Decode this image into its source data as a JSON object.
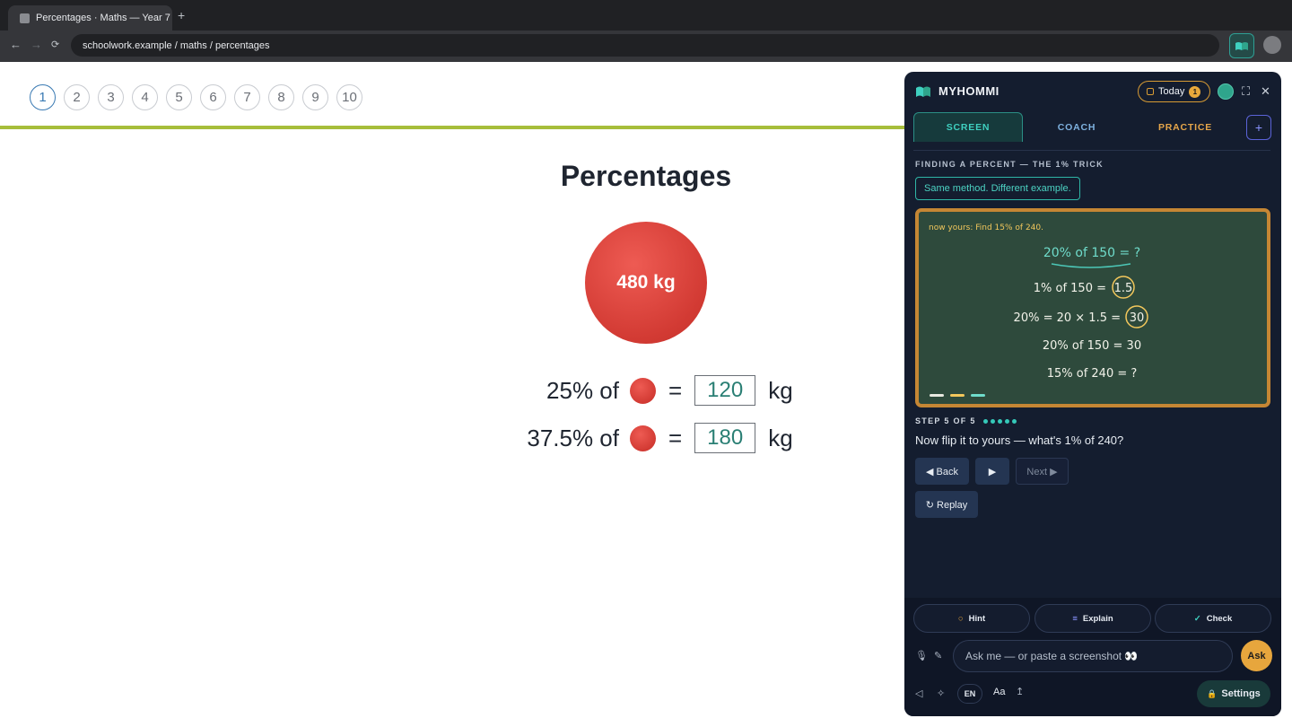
{
  "browser": {
    "tab_title": "Percentages · Maths — Year 7",
    "new_tab": "+",
    "back": "←",
    "forward": "→",
    "reload": "⟳",
    "url": "schoolwork.example / maths / percentages"
  },
  "page": {
    "questions": [
      "1",
      "2",
      "3",
      "4",
      "5",
      "6",
      "7",
      "8",
      "9",
      "10"
    ],
    "active_question": "1",
    "title": "Percentages",
    "ball_label": "480 kg",
    "equations": [
      {
        "percent": "25% of",
        "equals": "=",
        "answer": "120",
        "unit": "kg"
      },
      {
        "percent": "37.5% of",
        "equals": "=",
        "answer": "180",
        "unit": "kg"
      }
    ]
  },
  "panel": {
    "brand": "MYHOMMI",
    "today_label": "Today",
    "today_count": "1",
    "expand_icon": "⛶",
    "close_icon": "✕",
    "tabs": [
      "SCREEN",
      "COACH",
      "PRACTICE"
    ],
    "add_tab": "+",
    "section_label": "FINDING A PERCENT — THE 1% TRICK",
    "pill": "Same method. Different example.",
    "board": {
      "note": "now yours: Find 15% of 240.",
      "line1": "20% of 150 = ?",
      "line2_text": "1% of 150 =",
      "line2_answer": "1.5",
      "line3_text": "20% = 20 × 1.5 =",
      "line3_answer": "30",
      "line4": "20% of 150 = 30",
      "line5": "15% of 240 = ?"
    },
    "step_label": "STEP 5 OF 5",
    "prompt": "Now flip it to yours — what's 1% of 240?",
    "back_btn": "◀ Back",
    "play_btn": "▶",
    "next_btn": "Next ▶",
    "replay_btn": "↻ Replay",
    "actions": {
      "hint": "Hint",
      "explain": "Explain",
      "check": "Check"
    },
    "ask_placeholder": "Ask me — or paste a screenshot 👀",
    "ask_btn": "Ask",
    "lang": "EN",
    "text_size": "Aa",
    "settings": "Settings"
  },
  "colors": {
    "accent_teal": "#3fd0c0",
    "ball_red": "#d23a33",
    "amber": "#e7a63d",
    "chalkboard": "#2e4a3c"
  }
}
